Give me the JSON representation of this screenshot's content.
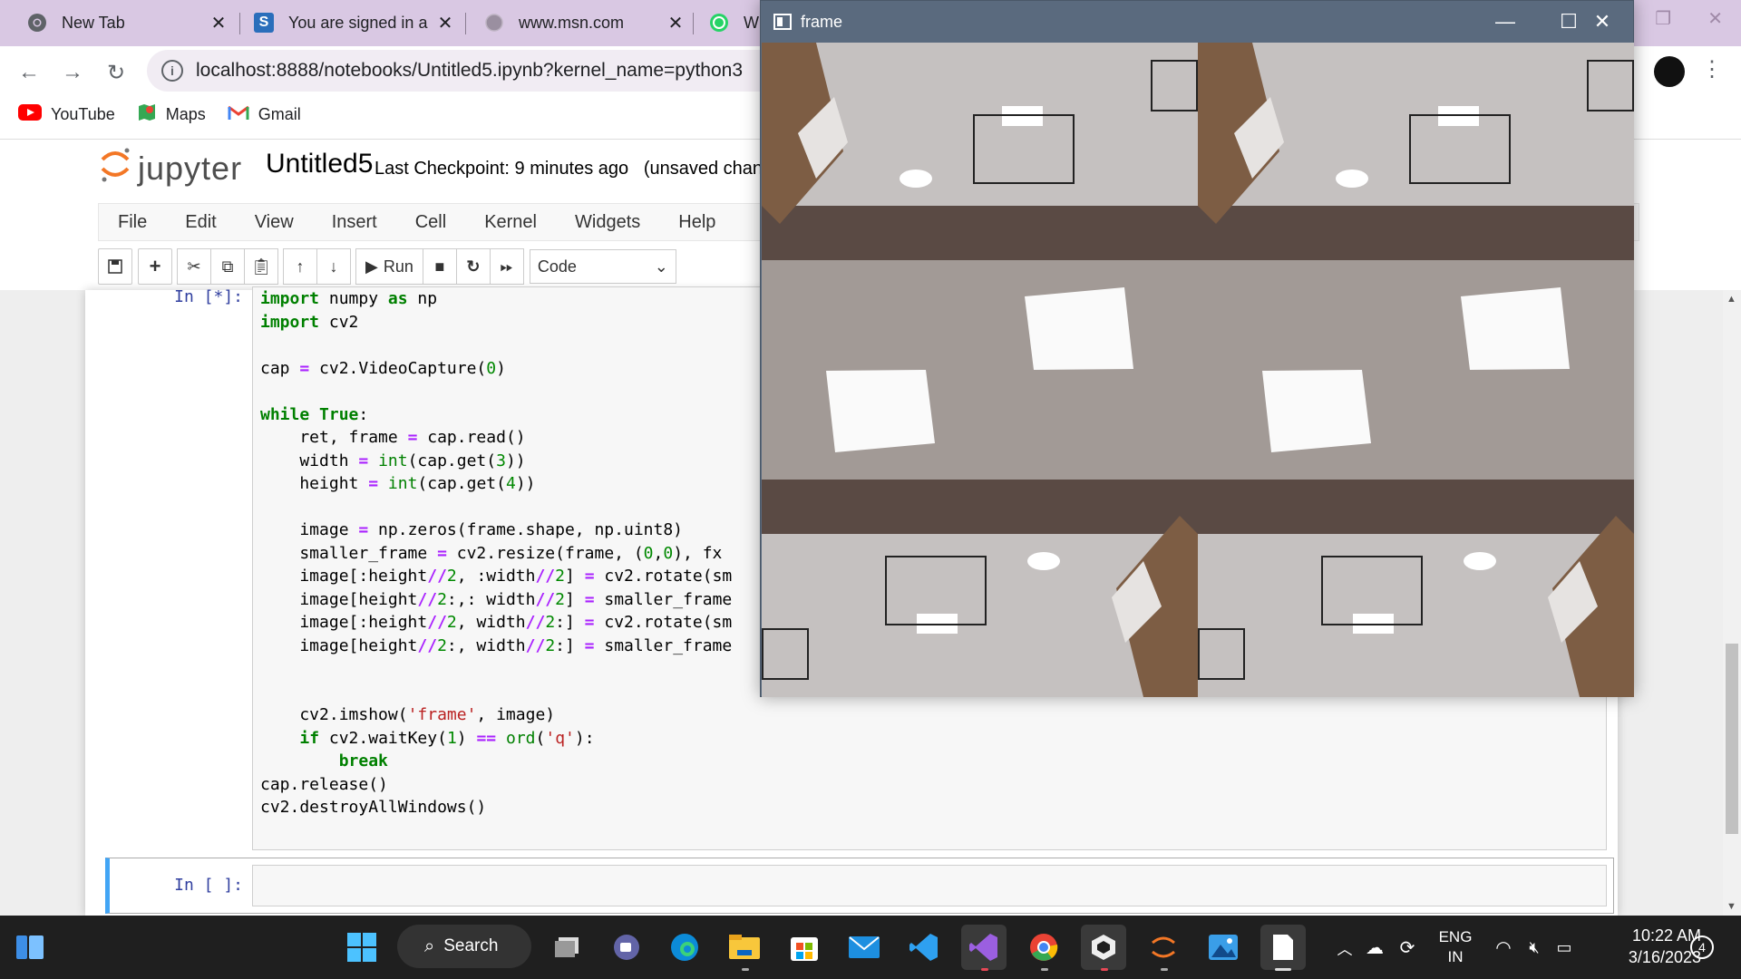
{
  "browser": {
    "tabs": [
      {
        "title": "New Tab",
        "icon": "chrome-icon"
      },
      {
        "title": "You are signed in a",
        "icon": "s-app-icon"
      },
      {
        "title": "www.msn.com",
        "icon": "globe-icon"
      },
      {
        "title": "Wh",
        "icon": "whatsapp-icon"
      }
    ],
    "url": "localhost:8888/notebooks/Untitled5.ipynb?kernel_name=python3",
    "bookmarks": [
      {
        "label": "YouTube",
        "icon": "youtube-icon"
      },
      {
        "label": "Maps",
        "icon": "maps-icon"
      },
      {
        "label": "Gmail",
        "icon": "gmail-icon"
      }
    ]
  },
  "jupyter": {
    "logo_text": "jupyter",
    "notebook_name": "Untitled5",
    "checkpoint": "Last Checkpoint: 9 minutes ago",
    "status": "(unsaved chang",
    "menu": [
      "File",
      "Edit",
      "View",
      "Insert",
      "Cell",
      "Kernel",
      "Widgets",
      "Help"
    ],
    "run_label": "Run",
    "cell_type": "Code",
    "cells": [
      {
        "prompt": "In [*]:"
      },
      {
        "prompt": "In [ ]:"
      }
    ]
  },
  "frame_window": {
    "title": "frame"
  },
  "taskbar": {
    "search_label": "Search",
    "language": "ENG",
    "region": "IN",
    "time": "10:22 AM",
    "date": "3/16/2023",
    "notifications": "4"
  },
  "colors": {
    "tabstrip": "#d9c8e3",
    "jupyter_prompt": "#303f9f",
    "cell_active": "#42a5f5",
    "taskbar": "#1f1f1f"
  }
}
